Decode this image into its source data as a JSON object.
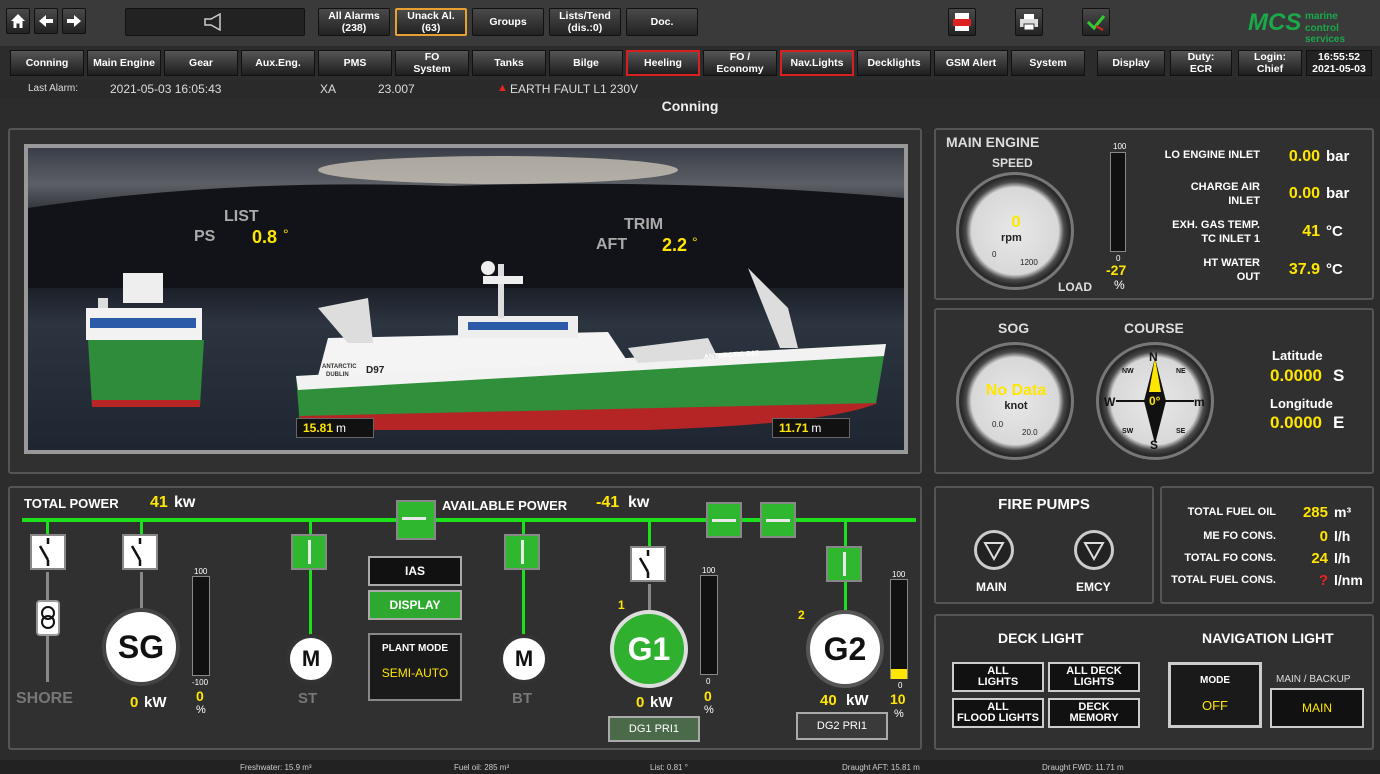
{
  "topbar": {
    "all_alarms": "All Alarms\n(238)",
    "unack": "Unack Al.\n(63)",
    "groups": "Groups",
    "lists": "Lists/Tend\n(dis.:0)",
    "doc": "Doc.",
    "brand_logo": "MCS",
    "brand_text_1": "marine",
    "brand_text_2": "control services"
  },
  "nav": {
    "items": [
      "Conning",
      "Main Engine",
      "Gear",
      "Aux.Eng.",
      "PMS",
      "FO\nSystem",
      "Tanks",
      "Bilge",
      "Heeling",
      "FO /\nEconomy",
      "Nav.Lights",
      "Decklights",
      "GSM Alert",
      "System"
    ],
    "display": "Display",
    "duty": "Duty:\nECR",
    "login": "Login:\nChief",
    "time": "16:55:52\n2021-05-03"
  },
  "alarmline": {
    "label": "Last Alarm:",
    "time": "2021-05-03 16:05:43",
    "tag": "XA",
    "code": "23.007",
    "message": "EARTH FAULT L1 230V"
  },
  "page_title": "Conning",
  "ship": {
    "list_label": "LIST",
    "list_side": "PS",
    "list_value": "0.8",
    "trim_label": "TRIM",
    "trim_side": "AFT",
    "trim_value": "2.2",
    "deg": "°",
    "draught_aft": "15.81",
    "draught_fwd": "11.71",
    "unit_m": "m",
    "hull_name": "ANTARCTIC",
    "hull_port": "DUBLIN",
    "hull_reg": "D97",
    "bow_text": "ANTARCTIC  D97"
  },
  "main_engine": {
    "title": "MAIN ENGINE",
    "speed_label": "SPEED",
    "speed_value": "0",
    "speed_unit": "rpm",
    "speed_min": "0",
    "speed_max": "1200",
    "load_label": "LOAD",
    "load_max": "100",
    "load_min": "0",
    "load_value": "-27",
    "load_unit": "%",
    "rows": [
      {
        "label": "LO ENGINE INLET",
        "value": "0.00",
        "unit": "bar"
      },
      {
        "label": "CHARGE AIR\nINLET",
        "value": "0.00",
        "unit": "bar"
      },
      {
        "label": "EXH. GAS TEMP.\nTC INLET 1",
        "value": "41",
        "unit": "°C"
      },
      {
        "label": "HT WATER\nOUT",
        "value": "37.9",
        "unit": "°C"
      }
    ]
  },
  "navigation": {
    "sog_label": "SOG",
    "sog_value": "No Data",
    "sog_unit": "knot",
    "sog_min": "0.0",
    "sog_max": "20.0",
    "course_label": "COURSE",
    "course_value": "0°",
    "compass": {
      "n": "N",
      "s": "S",
      "e": "E",
      "w": "W",
      "ne": "NE",
      "nw": "NW",
      "se": "SE",
      "sw": "SW",
      "m": "m"
    },
    "lat_label": "Latitude",
    "lat_value": "0.0000",
    "lat_hemi": "S",
    "lon_label": "Longitude",
    "lon_value": "0.0000",
    "lon_hemi": "E"
  },
  "power": {
    "total_label": "TOTAL POWER",
    "total_value": "41",
    "total_unit": "kw",
    "avail_label": "AVAILABLE POWER",
    "avail_value": "-41",
    "avail_unit": "kw",
    "shore_label": "SHORE",
    "sg_label": "SG",
    "sg_kw": "0",
    "sg_pct_max": "100",
    "sg_pct_min": "-100",
    "sg_pct": "0",
    "st_label": "ST",
    "bt_label": "BT",
    "motor": "M",
    "ias": "IAS",
    "display": "DISPLAY",
    "plant_mode_label": "PLANT MODE",
    "plant_mode_value": "SEMI-AUTO",
    "g1_label": "G1",
    "g1_num": "1",
    "g1_kw": "0",
    "g1_pct_max": "100",
    "g1_pct_min": "0",
    "g1_pct": "0",
    "g1_btn": "DG1 PRI1",
    "g2_label": "G2",
    "g2_num": "2",
    "g2_kw": "40",
    "g2_pct_max": "100",
    "g2_pct_min": "0",
    "g2_pct": "10",
    "g2_btn": "DG2 PRI1",
    "kw": "kW",
    "pct": "%"
  },
  "fire": {
    "title": "FIRE PUMPS",
    "main": "MAIN",
    "emcy": "EMCY"
  },
  "fuel": {
    "rows": [
      {
        "label": "TOTAL FUEL OIL",
        "value": "285",
        "unit": "m³"
      },
      {
        "label": "ME FO CONS.",
        "value": "0",
        "unit": "l/h"
      },
      {
        "label": "TOTAL FO CONS.",
        "value": "24",
        "unit": "l/h"
      },
      {
        "label": "TOTAL FUEL CONS.",
        "value": "?",
        "unit": "l/nm"
      }
    ]
  },
  "lights": {
    "deck_title": "DECK LIGHT",
    "nav_title": "NAVIGATION LIGHT",
    "all_lights": "ALL\nLIGHTS",
    "all_deck": "ALL DECK\nLIGHTS",
    "all_flood": "ALL\nFLOOD LIGHTS",
    "deck_memory": "DECK\nMEMORY",
    "mode_label": "MODE",
    "mode_value": "OFF",
    "main_backup_label": "MAIN / BACKUP",
    "main_backup_value": "MAIN"
  },
  "footer": {
    "freshwater": "Freshwater: 15.9 m³",
    "fueloil": "Fuel oil: 285 m³",
    "list": "List: 0.81 °",
    "draught_aft": "Draught AFT: 15.81 m",
    "draught_fwd": "Draught FWD: 11.71 m"
  },
  "colors": {
    "accent": "#ffe600",
    "bus": "#1de01d",
    "alarm": "#d82020",
    "brand": "#1aa84a"
  }
}
